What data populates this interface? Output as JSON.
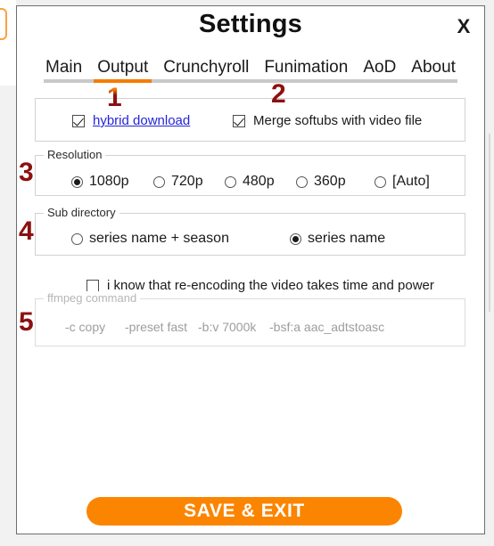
{
  "window": {
    "title": "Settings",
    "close_label": "X"
  },
  "tabs": [
    {
      "label": "Main",
      "active": false
    },
    {
      "label": "Output",
      "active": true
    },
    {
      "label": "Crunchyroll",
      "active": false
    },
    {
      "label": "Funimation",
      "active": false
    },
    {
      "label": "AoD",
      "active": false
    },
    {
      "label": "About",
      "active": false
    }
  ],
  "annotations": {
    "n1": "1",
    "n2": "2",
    "n3": "3",
    "n4": "4",
    "n5": "5"
  },
  "download_options": {
    "hybrid_download": {
      "label": "hybrid download",
      "checked": true,
      "is_link": true
    },
    "merge_softubs": {
      "label": "Merge softubs with video file",
      "checked": true,
      "is_link": false
    }
  },
  "resolution": {
    "legend": "Resolution",
    "options": [
      {
        "label": "1080p",
        "selected": true
      },
      {
        "label": "720p",
        "selected": false
      },
      {
        "label": "480p",
        "selected": false
      },
      {
        "label": "360p",
        "selected": false
      },
      {
        "label": "[Auto]",
        "selected": false
      }
    ]
  },
  "sub_directory": {
    "legend": "Sub directory",
    "options": [
      {
        "label": "series name + season",
        "selected": false
      },
      {
        "label": "series name",
        "selected": true
      }
    ]
  },
  "reencode": {
    "label": "i know that re-encoding the video takes time and power",
    "checked": false
  },
  "ffmpeg": {
    "legend": "ffmpeg command",
    "disabled": true,
    "fields": [
      {
        "value": "-c copy"
      },
      {
        "value": "-preset fast"
      },
      {
        "value": "-b:v 7000k"
      },
      {
        "value": "-bsf:a aac_adtstoasc"
      }
    ]
  },
  "footer": {
    "save_label": "SAVE & EXIT"
  },
  "colors": {
    "accent_orange": "#fb8500",
    "tab_underline": "#f57c00",
    "annotation_red": "#8b1111",
    "link_blue": "#2424d8"
  }
}
